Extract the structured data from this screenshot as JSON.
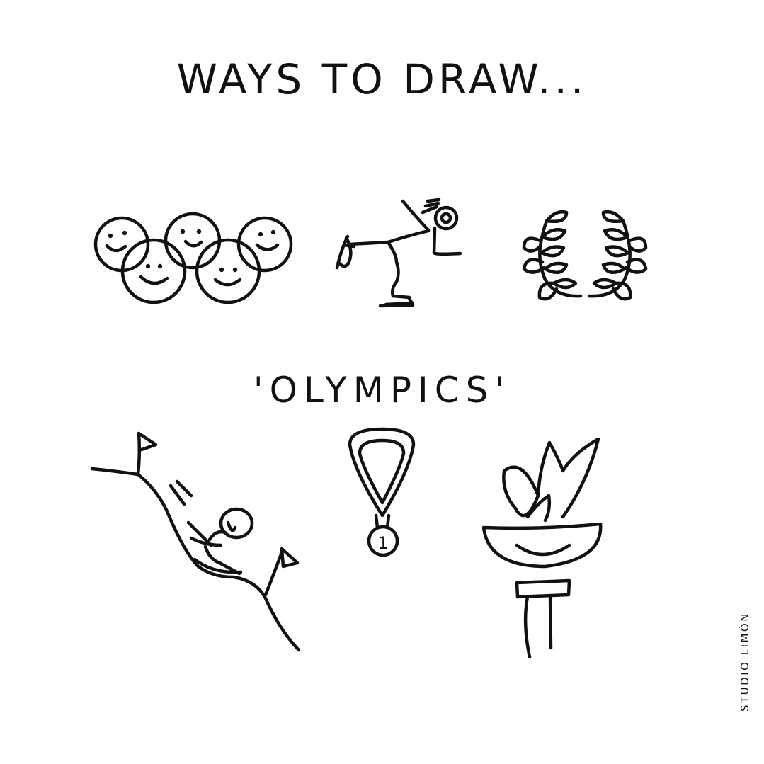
{
  "title": "WAYS TO DRAW...",
  "subtitle": "'OLYMPICS'",
  "credit": "STUDIO LIMÓN",
  "medal_number": "1",
  "illustrations": [
    "smiling-olympic-rings-icon",
    "speed-skater-icon",
    "laurel-wreath-icon",
    "skier-on-slope-icon",
    "gold-medal-icon",
    "olympic-torch-icon"
  ],
  "colors": {
    "ink": "#111111",
    "background": "#ffffff"
  }
}
